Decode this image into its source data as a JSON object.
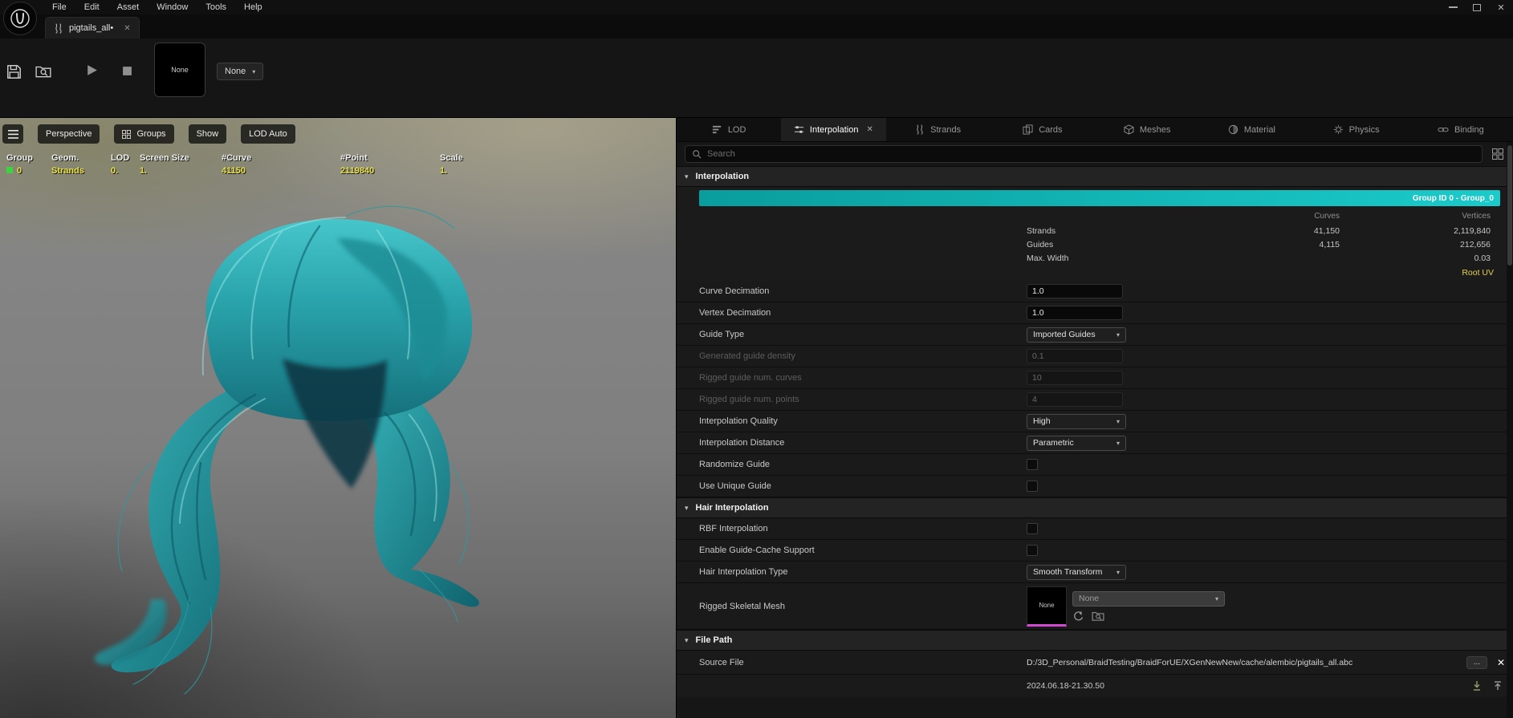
{
  "icons": {
    "close": "✕",
    "caret": "▾",
    "ellipsis": "..."
  },
  "colors": {
    "teal": "#12b9b9",
    "magenta": "#d24ad2",
    "yellow": "#e5d04a",
    "panel_bg": "#161616"
  },
  "menubar": {
    "items": [
      "File",
      "Edit",
      "Asset",
      "Window",
      "Tools",
      "Help"
    ]
  },
  "asset_tab": {
    "title": "pigtails_all•"
  },
  "toolbar": {
    "simulation_thumb_label": "None",
    "simulation_options_label": "None"
  },
  "viewport": {
    "toolbar": {
      "perspective": "Perspective",
      "groups": "Groups",
      "show": "Show",
      "lod": "LOD Auto"
    },
    "debug": {
      "headers": [
        "Group",
        "Geom.",
        "LOD",
        "Screen Size",
        "#Curve",
        "#Point",
        "Scale"
      ],
      "values": [
        "0",
        "Strands",
        "0.",
        "1.",
        "41150",
        "2119840",
        "1."
      ]
    }
  },
  "details": {
    "tabs": [
      {
        "label": "LOD"
      },
      {
        "label": "Interpolation",
        "active": true
      },
      {
        "label": "Strands"
      },
      {
        "label": "Cards"
      },
      {
        "label": "Meshes"
      },
      {
        "label": "Material"
      },
      {
        "label": "Physics"
      },
      {
        "label": "Binding"
      }
    ],
    "search": {
      "placeholder": "Search"
    },
    "interpolation": {
      "section_label": "Interpolation",
      "group_banner": "Group ID 0 - Group_0",
      "stats": {
        "col_headers": [
          "Curves",
          "Vertices"
        ],
        "rows": [
          {
            "label": "Strands",
            "curves": "41,150",
            "vertices": "2,119,840"
          },
          {
            "label": "Guides",
            "curves": "4,115",
            "vertices": "212,656"
          },
          {
            "label": "Max. Width",
            "curves": "",
            "vertices": "0.03"
          }
        ],
        "link": "Root UV"
      },
      "properties": [
        {
          "label": "Curve Decimation",
          "value": "1.0"
        },
        {
          "label": "Vertex Decimation",
          "value": "1.0"
        },
        {
          "label": "Guide Type",
          "value": "Imported Guides"
        },
        {
          "label": "Generated guide density",
          "value": "0.1"
        },
        {
          "label": "Rigged guide num. curves",
          "value": "10"
        },
        {
          "label": "Rigged guide num. points",
          "value": "4"
        },
        {
          "label": "Interpolation Quality",
          "value": "High"
        },
        {
          "label": "Interpolation Distance",
          "value": "Parametric"
        },
        {
          "label": "Randomize Guide"
        },
        {
          "label": "Use Unique Guide"
        }
      ]
    },
    "hair_interpolation": {
      "section_label": "Hair Interpolation",
      "properties": [
        {
          "label": "RBF Interpolation"
        },
        {
          "label": "Enable Guide-Cache Support"
        },
        {
          "label": "Hair Interpolation Type",
          "value": "Smooth Transform"
        },
        {
          "label": "Rigged Skeletal Mesh",
          "thumb_label": "None",
          "value": "None"
        }
      ]
    },
    "file_path": {
      "section_label": "File Path",
      "source_file_label": "Source File",
      "source_file_value": "D:/3D_Personal/BraidTesting/BraidForUE/XGenNewNew/cache/alembic/pigtails_all.abc",
      "timestamp": "2024.06.18-21.30.50"
    }
  }
}
